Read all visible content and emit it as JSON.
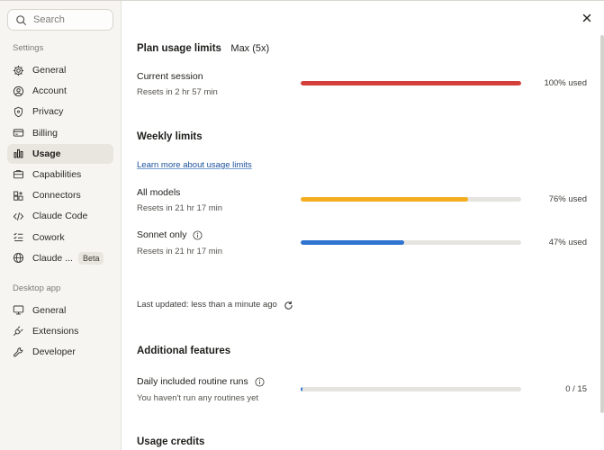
{
  "search": {
    "placeholder": "Search"
  },
  "sidebar": {
    "settings_label": "Settings",
    "settings_items": [
      {
        "label": "General",
        "icon": "gear-icon"
      },
      {
        "label": "Account",
        "icon": "user-circle-icon"
      },
      {
        "label": "Privacy",
        "icon": "shield-icon"
      },
      {
        "label": "Billing",
        "icon": "credit-card-icon"
      },
      {
        "label": "Usage",
        "icon": "bar-chart-icon",
        "active": true
      },
      {
        "label": "Capabilities",
        "icon": "briefcase-icon"
      },
      {
        "label": "Connectors",
        "icon": "connectors-icon"
      },
      {
        "label": "Claude Code",
        "icon": "code-icon"
      },
      {
        "label": "Cowork",
        "icon": "checklist-icon"
      },
      {
        "label": "Claude ...",
        "icon": "globe-icon",
        "badge": "Beta"
      }
    ],
    "desktop_label": "Desktop app",
    "desktop_items": [
      {
        "label": "General",
        "icon": "monitor-icon"
      },
      {
        "label": "Extensions",
        "icon": "plug-icon"
      },
      {
        "label": "Developer",
        "icon": "wrench-icon"
      }
    ]
  },
  "plan": {
    "title": "Plan usage limits",
    "tier": "Max (5x)",
    "current_session": {
      "label": "Current session",
      "reset": "Resets in 2 hr 57 min",
      "percent_text": "100% used",
      "value": 100,
      "color": "#d33f3a"
    }
  },
  "weekly": {
    "title": "Weekly limits",
    "link": "Learn more about usage limits",
    "all_models": {
      "label": "All models",
      "reset": "Resets in 21 hr 17 min",
      "percent_text": "76% used",
      "value": 76,
      "color": "#f4ad1e"
    },
    "sonnet": {
      "label": "Sonnet only",
      "reset": "Resets in 21 hr 17 min",
      "percent_text": "47% used",
      "value": 47,
      "color": "#2f74d0"
    },
    "last_updated": "Last updated: less than a minute ago"
  },
  "additional": {
    "title": "Additional features",
    "routine": {
      "label": "Daily included routine runs",
      "sub": "You haven't run any routines yet",
      "count_text": "0 / 15",
      "value": 1,
      "color": "#2f74d0"
    }
  },
  "credits": {
    "title": "Usage credits"
  }
}
